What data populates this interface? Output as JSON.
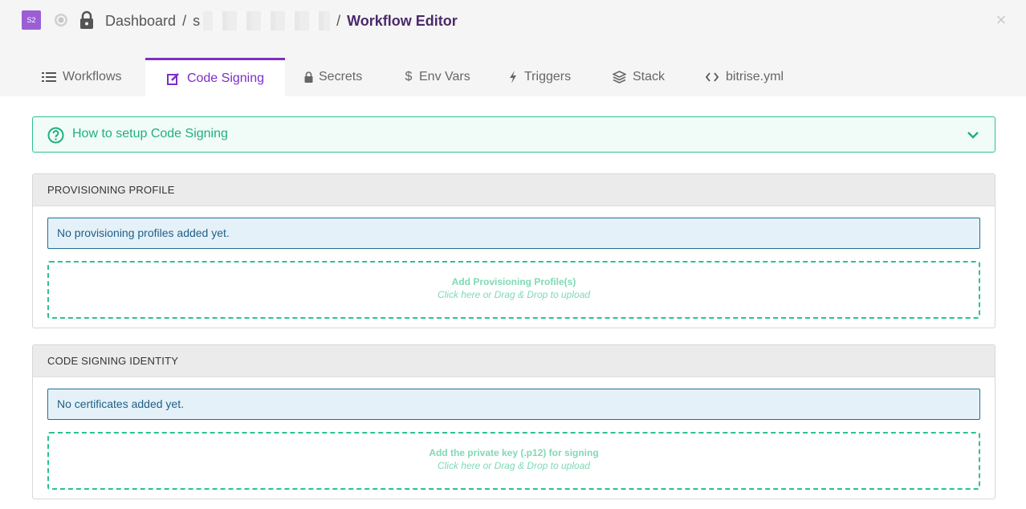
{
  "header": {
    "app_avatar": "S2",
    "breadcrumb_home": "Dashboard",
    "breadcrumb_separator": "/",
    "breadcrumb_app_visible": "s",
    "breadcrumb_current": "Workflow Editor",
    "close_glyph": "×"
  },
  "tabs": [
    {
      "label": "Workflows",
      "icon": "list-icon"
    },
    {
      "label": "Code Signing",
      "icon": "edit-icon",
      "active": true
    },
    {
      "label": "Secrets",
      "icon": "lock-icon"
    },
    {
      "label": "Env Vars",
      "icon": "dollar-icon"
    },
    {
      "label": "Triggers",
      "icon": "bolt-icon"
    },
    {
      "label": "Stack",
      "icon": "layers-icon"
    },
    {
      "label": "bitrise.yml",
      "icon": "code-icon"
    }
  ],
  "help": {
    "label": "How to setup Code Signing"
  },
  "provisioning": {
    "title": "PROVISIONING PROFILE",
    "notice": "No provisioning profiles added yet.",
    "dropzone_title": "Add Provisioning Profile(s)",
    "dropzone_sub": "Click here or Drag & Drop to upload"
  },
  "identity": {
    "title": "CODE SIGNING IDENTITY",
    "notice": "No certificates added yet.",
    "dropzone_title": "Add the private key (.p12) for signing",
    "dropzone_sub": "Click here or Drag & Drop to upload"
  },
  "colors": {
    "accent": "#7b2fc9",
    "success": "#2dc28e",
    "info": "#1e6f97"
  }
}
